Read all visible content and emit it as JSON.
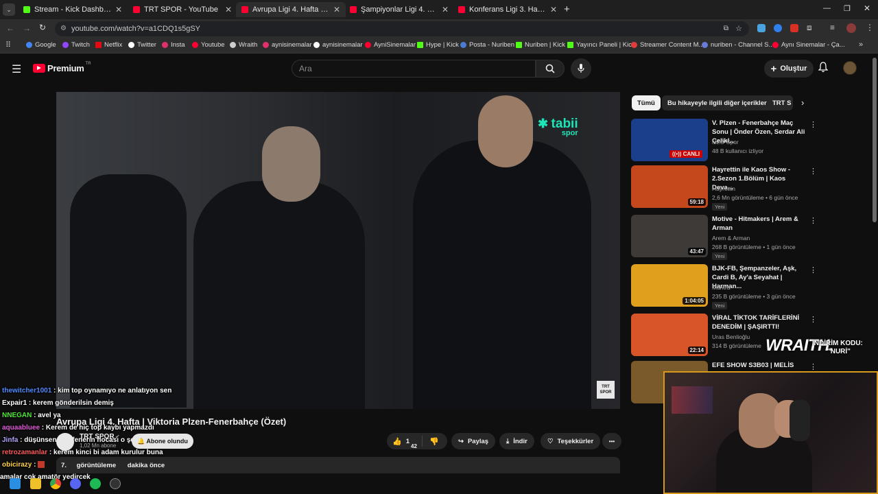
{
  "browser": {
    "tabs": [
      {
        "title": "Stream - Kick Dashboard",
        "favicon_color": "#53fc18"
      },
      {
        "title": "TRT SPOR - YouTube",
        "favicon_color": "#ff0033"
      },
      {
        "title": "Avrupa Ligi 4. Hafta | Viktoria P",
        "favicon_color": "#ff0033"
      },
      {
        "title": "Şampiyonlar Ligi 4. Hafta | Club",
        "favicon_color": "#ff0033"
      },
      {
        "title": "Konferans Ligi 3. Hafta | Samsun",
        "favicon_color": "#ff0033"
      }
    ],
    "new_tab_label": "+",
    "address": "youtube.com/watch?v=a1CDQ1s5gSY",
    "bookmarks": [
      "Google",
      "Twitch",
      "Netflix",
      "Twitter",
      "Insta",
      "Youtube",
      "Wraith",
      "aynisinemalar",
      "aynisinemalar",
      "AyniSinemalar",
      "Hype | Kick",
      "Posta - Nuriben",
      "Nuriben | Kick",
      "Yayıncı Paneli | Kick",
      "Streamer Content M...",
      "nuriben - Channel S...",
      "Aynı Sinemalar - Ça..."
    ]
  },
  "youtube": {
    "logo_text": "Premium",
    "logo_sup": "TR",
    "search_placeholder": "Ara",
    "create_label": "Oluştur"
  },
  "video": {
    "watermark_brand": "tabii",
    "watermark_sub": "spor",
    "corner_logo": "TRT SPOR",
    "title": "Avrupa Ligi 4. Hafta | Viktoria Plzen-Fenerbahçe (Özet)",
    "channel": "TRT SPOR",
    "subscribers": "1,02 Mn abone",
    "subscribed_label": "Abone olundu",
    "views_label": "görüntüleme",
    "views_frag": "7.",
    "time_label": "dakika önce",
    "like_count": "1",
    "like_sub": "42"
  },
  "actions": {
    "share": "Paylaş",
    "download": "İndir",
    "thanks": "Teşekkürler",
    "more": "•••"
  },
  "chips": [
    "Tümü",
    "Bu hikayeyle ilgili diğer içerikler",
    "TRT S"
  ],
  "recommendations": [
    {
      "title": "V. Plzen - Fenerbahçe Maç Sonu | Önder Özen, Serdar Ali Çelikl...",
      "channel": "NEO Spor",
      "stats": "48 B kullanıcı izliyor",
      "badge": "CANLI",
      "duration": "",
      "new": false,
      "thumb": "#1b3f8a"
    },
    {
      "title": "Hayrettin ile Kaos Show - 2.Sezon 1.Bölüm | Kaos Deva...",
      "channel": "Hayrettin",
      "stats": "2,6 Mn görüntüleme • 6 gün önce",
      "badge": "",
      "duration": "59:18",
      "new": true,
      "thumb": "#c5471c"
    },
    {
      "title": "Motive - Hitmakers | Arem & Arman",
      "channel": "Arem & Arman",
      "stats": "268 B görüntüleme • 1 gün önce",
      "badge": "",
      "duration": "43:47",
      "new": true,
      "thumb": "#3d3a37"
    },
    {
      "title": "BJK-FB, Şempanzeler, Aşk, Cardi B, Ay'a Seyahat | Harman...",
      "channel": "Mantra",
      "stats": "235 B görüntüleme • 3 gün önce",
      "badge": "",
      "duration": "1:04:05",
      "new": true,
      "thumb": "#e0a01e"
    },
    {
      "title": "VİRAL TİKTOK TARİFLERİNİ DENEDİM | ŞAŞIRTTI!",
      "channel": "Uras Benlioğlu",
      "stats": "314 B görüntüleme",
      "badge": "",
      "duration": "22:14",
      "new": false,
      "thumb": "#d8552a"
    },
    {
      "title": "EFE SHOW S3B03 | MELİS",
      "channel": "",
      "stats": "",
      "badge": "",
      "duration": "",
      "new": false,
      "thumb": "#7a5a2a"
    }
  ],
  "chat": [
    {
      "user": "thewitcher1001",
      "msg": "kim top oynamıyo ne anlatıyon sen",
      "color": "#4f8cff"
    },
    {
      "user": "Expair1",
      "msg": "kerem gönderilsin demiş",
      "color": "#ffffff"
    },
    {
      "user": "NNEGAN",
      "msg": "avel ya",
      "color": "#52e63a"
    },
    {
      "user": "aquaabluee",
      "msg": "Kerem de hiç top kaybı yapmazdı",
      "color": "#e15bd8"
    },
    {
      "user": "Jinfa",
      "msg": "düşünsene şu fenerin hocası o şekilde olurdu",
      "color": "#b9a6ff"
    },
    {
      "user": "retrozamanlar",
      "msg": "kerem kinci bi adam kurulur buna",
      "color": "#ff5a5a"
    },
    {
      "user": "obicirazy",
      "msg": "",
      "color": "#ffd24a"
    },
    {
      "user": "",
      "msg": "amalar cok amatör yedircek",
      "color": "#ffffff"
    }
  ],
  "sponsor": {
    "brand": "WRAITH.",
    "promo_label": "İNDİRİM KODU:",
    "promo_code": "\"NURİ\""
  },
  "colors": {
    "accent": "#ff0033",
    "bg": "#0f0f0f",
    "cam_border": "#d79a1c"
  }
}
